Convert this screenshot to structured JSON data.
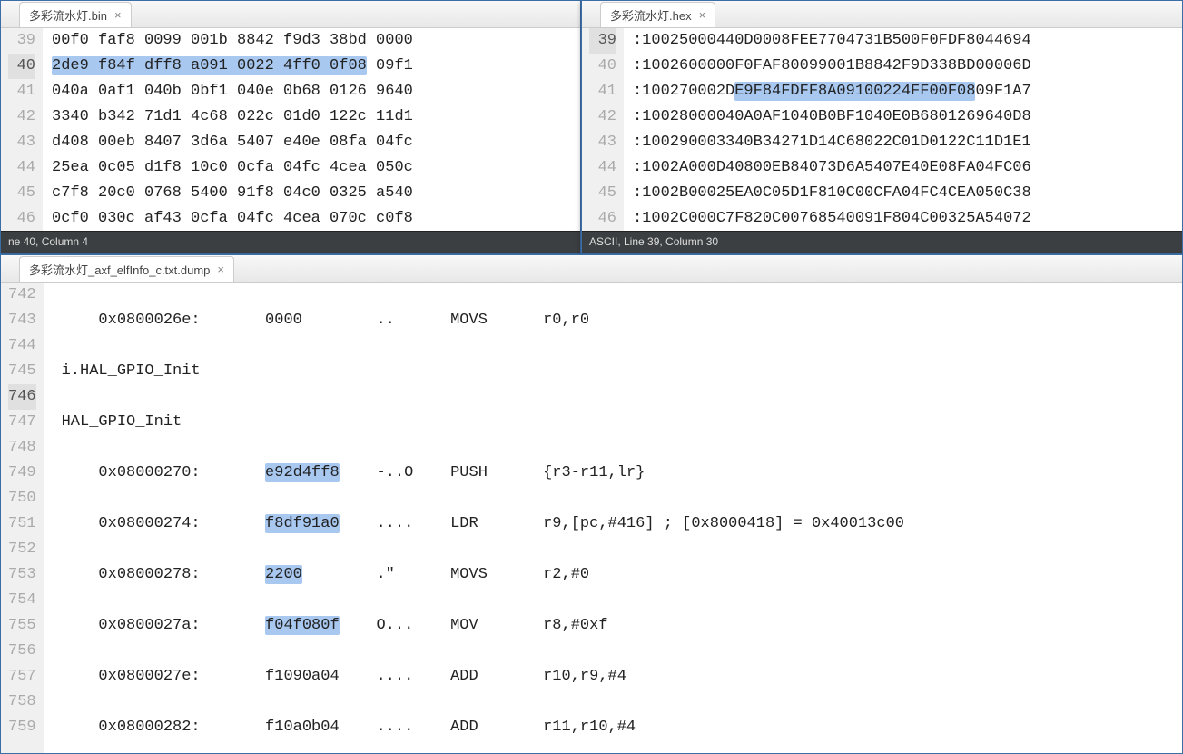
{
  "win1": {
    "tab": "多彩流水灯.bin",
    "status": "ne 40, Column 4",
    "lines": [
      {
        "n": "39",
        "pre": "",
        "hl": "",
        "post": "00f0 faf8 0099 001b 8842 f9d3 38bd 0000"
      },
      {
        "n": "40",
        "pre": "",
        "hl": "2de9 f84f dff8 a091 0022 4ff0 0f08",
        "post": " 09f1"
      },
      {
        "n": "41",
        "pre": "",
        "hl": "",
        "post": "040a 0af1 040b 0bf1 040e 0b68 0126 9640"
      },
      {
        "n": "42",
        "pre": "",
        "hl": "",
        "post": "3340 b342 71d1 4c68 022c 01d0 122c 11d1"
      },
      {
        "n": "43",
        "pre": "",
        "hl": "",
        "post": "d408 00eb 8407 3d6a 5407 e40e 08fa 04fc"
      },
      {
        "n": "44",
        "pre": "",
        "hl": "",
        "post": "25ea 0c05 d1f8 10c0 0cfa 04fc 4cea 050c"
      },
      {
        "n": "45",
        "pre": "",
        "hl": "",
        "post": "c7f8 20c0 0768 5400 91f8 04c0 0325 a540"
      },
      {
        "n": "46",
        "pre": "",
        "hl": "",
        "post": "0cf0 030c af43 0cfa 04fc 4cea 070c c0f8"
      }
    ]
  },
  "win2": {
    "tab": "多彩流水灯.hex",
    "status": "ASCII, Line 39, Column 30",
    "lines": [
      {
        "n": "39",
        "pre": ":10025000440D0008FEE7704731B500F0FDF8044694",
        "hl": "",
        "post": ""
      },
      {
        "n": "40",
        "pre": ":1002600000F0FAF80099001B8842F9D338BD00006D",
        "hl": "",
        "post": ""
      },
      {
        "n": "41",
        "pre": ":100270002D",
        "hl": "E9F84FDFF8A09100224FF00F08",
        "post": "09F1A7"
      },
      {
        "n": "42",
        "pre": ":10028000040A0AF1040B0BF1040E0B6801269640D8",
        "hl": "",
        "post": ""
      },
      {
        "n": "43",
        "pre": ":100290003340B34271D14C68022C01D0122C11D1E1",
        "hl": "",
        "post": ""
      },
      {
        "n": "44",
        "pre": ":1002A000D40800EB84073D6A5407E40E08FA04FC06",
        "hl": "",
        "post": ""
      },
      {
        "n": "45",
        "pre": ":1002B00025EA0C05D1F810C00CFA04FC4CEA050C38",
        "hl": "",
        "post": ""
      },
      {
        "n": "46",
        "pre": ":1002C000C7F820C00768540091F804C00325A54072",
        "hl": "",
        "post": ""
      }
    ]
  },
  "win3": {
    "tab": "多彩流水灯_axf_elfInfo_c.txt.dump",
    "lines": [
      {
        "n": "742",
        "addr": "",
        "code": "",
        "hl": false,
        "ascii": "",
        "mnem": "",
        "ops": ""
      },
      {
        "n": "743",
        "addr": "0x0800026e:",
        "code": "0000",
        "hl": false,
        "ascii": "..",
        "mnem": "MOVS",
        "ops": "r0,r0"
      },
      {
        "n": "744",
        "addr": "",
        "code": "",
        "hl": false,
        "ascii": "",
        "mnem": "",
        "ops": ""
      },
      {
        "n": "745",
        "addr": "",
        "code": "",
        "hl": false,
        "ascii": "",
        "mnem": "",
        "ops": "",
        "label": "i.HAL_GPIO_Init"
      },
      {
        "n": "746",
        "addr": "",
        "code": "",
        "hl": false,
        "ascii": "",
        "mnem": "",
        "ops": ""
      },
      {
        "n": "747",
        "addr": "",
        "code": "",
        "hl": false,
        "ascii": "",
        "mnem": "",
        "ops": "",
        "label": "HAL_GPIO_Init"
      },
      {
        "n": "748",
        "addr": "",
        "code": "",
        "hl": false,
        "ascii": "",
        "mnem": "",
        "ops": ""
      },
      {
        "n": "749",
        "addr": "0x08000270:",
        "code": "e92d4ff8",
        "hl": true,
        "ascii": "-..O",
        "mnem": "PUSH",
        "ops": "{r3-r11,lr}"
      },
      {
        "n": "750",
        "addr": "",
        "code": "",
        "hl": false,
        "ascii": "",
        "mnem": "",
        "ops": ""
      },
      {
        "n": "751",
        "addr": "0x08000274:",
        "code": "f8df91a0",
        "hl": true,
        "ascii": "....",
        "mnem": "LDR",
        "ops": "r9,[pc,#416] ; [0x8000418] = 0x40013c00"
      },
      {
        "n": "752",
        "addr": "",
        "code": "",
        "hl": false,
        "ascii": "",
        "mnem": "",
        "ops": ""
      },
      {
        "n": "753",
        "addr": "0x08000278:",
        "code": "2200",
        "hl": true,
        "ascii": ".\"",
        "mnem": "MOVS",
        "ops": "r2,#0"
      },
      {
        "n": "754",
        "addr": "",
        "code": "",
        "hl": false,
        "ascii": "",
        "mnem": "",
        "ops": ""
      },
      {
        "n": "755",
        "addr": "0x0800027a:",
        "code": "f04f080f",
        "hl": true,
        "ascii": "O...",
        "mnem": "MOV",
        "ops": "r8,#0xf"
      },
      {
        "n": "756",
        "addr": "",
        "code": "",
        "hl": false,
        "ascii": "",
        "mnem": "",
        "ops": ""
      },
      {
        "n": "757",
        "addr": "0x0800027e:",
        "code": "f1090a04",
        "hl": false,
        "ascii": "....",
        "mnem": "ADD",
        "ops": "r10,r9,#4"
      },
      {
        "n": "758",
        "addr": "",
        "code": "",
        "hl": false,
        "ascii": "",
        "mnem": "",
        "ops": ""
      },
      {
        "n": "759",
        "addr": "0x08000282:",
        "code": "f10a0b04",
        "hl": false,
        "ascii": "....",
        "mnem": "ADD",
        "ops": "r11,r10,#4"
      }
    ]
  }
}
